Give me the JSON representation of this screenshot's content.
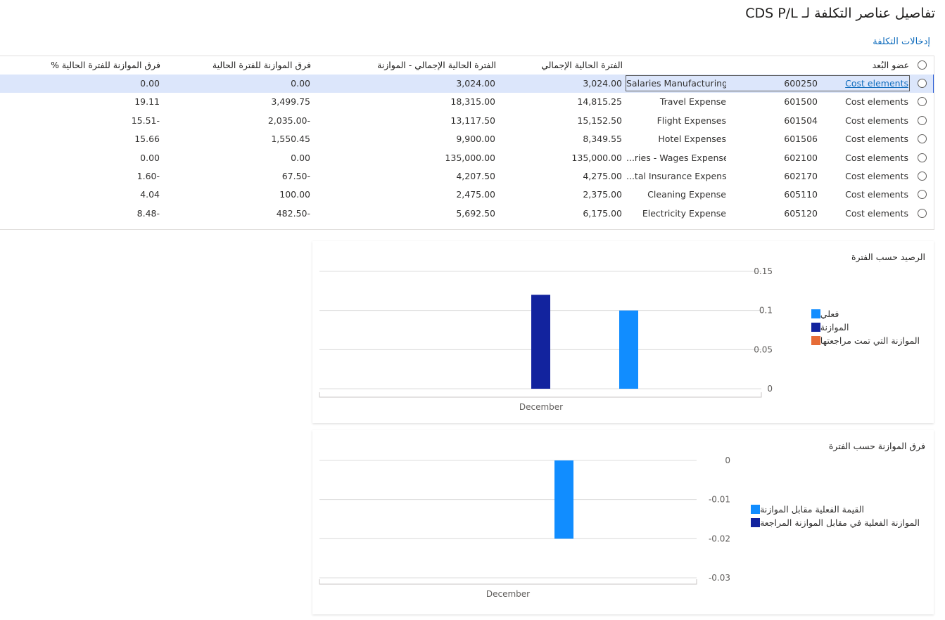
{
  "page": {
    "title": "تفاصيل عناصر التكلفة لـ CDS P/L",
    "entries_link": "إدخالات التكلفة"
  },
  "grid": {
    "headers": {
      "member": "عضو البُعد",
      "current_total": "الفترة الحالية الإجمالي",
      "current_minus_budget": "الفترة الحالية الإجمالي - الموازنة",
      "budget_variance": "فرق الموازنة للفترة الحالية",
      "budget_variance_pct": "فرق الموازنة للفترة الحالية %"
    },
    "rows": [
      {
        "type": "Cost elements",
        "code": "600250",
        "name": "Salaries Manufacturing",
        "current_total": "3,024.00",
        "current_minus_budget": "3,024.00",
        "variance": "0.00",
        "variance_pct": "0.00"
      },
      {
        "type": "Cost elements",
        "code": "601500",
        "name": "Travel Expense",
        "current_total": "14,815.25",
        "current_minus_budget": "18,315.00",
        "variance": "3,499.75",
        "variance_pct": "19.11"
      },
      {
        "type": "Cost elements",
        "code": "601504",
        "name": "Flight Expenses",
        "current_total": "15,152.50",
        "current_minus_budget": "13,117.50",
        "variance": "-2,035.00",
        "variance_pct": "-15.51"
      },
      {
        "type": "Cost elements",
        "code": "601506",
        "name": "Hotel Expenses",
        "current_total": "8,349.55",
        "current_minus_budget": "9,900.00",
        "variance": "1,550.45",
        "variance_pct": "15.66"
      },
      {
        "type": "Cost elements",
        "code": "602100",
        "name": "...ries - Wages Expense",
        "current_total": "135,000.00",
        "current_minus_budget": "135,000.00",
        "variance": "0.00",
        "variance_pct": "0.00"
      },
      {
        "type": "Cost elements",
        "code": "602170",
        "name": "...tal Insurance Expense",
        "current_total": "4,275.00",
        "current_minus_budget": "4,207.50",
        "variance": "-67.50",
        "variance_pct": "-1.60"
      },
      {
        "type": "Cost elements",
        "code": "605110",
        "name": "Cleaning Expense",
        "current_total": "2,375.00",
        "current_minus_budget": "2,475.00",
        "variance": "100.00",
        "variance_pct": "4.04"
      },
      {
        "type": "Cost elements",
        "code": "605120",
        "name": "Electricity Expense",
        "current_total": "6,175.00",
        "current_minus_budget": "5,692.50",
        "variance": "-482.50",
        "variance_pct": "-8.48"
      }
    ]
  },
  "colors": {
    "actual": "#118dff",
    "budget": "#12239e",
    "revised_budget": "#e66c37",
    "selected_row": "#dce6fb",
    "link": "#0f6cbd"
  },
  "chart_data": [
    {
      "type": "bar",
      "title": "الرصيد حسب الفترة",
      "categories": [
        "December"
      ],
      "series": [
        {
          "name": "فعلي",
          "values": [
            0.1
          ]
        },
        {
          "name": "الموازنة",
          "values": [
            0.12
          ]
        },
        {
          "name": "الموازنة التي تمت مراجعتها",
          "values": [
            0
          ]
        }
      ],
      "y_ticks": [
        "0.15",
        "0.1",
        "0.05",
        "0"
      ],
      "ylim": [
        0,
        0.15
      ],
      "grid": true,
      "legend": "right"
    },
    {
      "type": "bar",
      "title": "فرق الموازنة حسب الفترة",
      "categories": [
        "December"
      ],
      "series": [
        {
          "name": "القيمة الفعلية مقابل الموازنة",
          "values": [
            -0.02
          ]
        },
        {
          "name": "الموازنة الفعلية في مقابل الموازنة المراجعة",
          "values": [
            0
          ]
        }
      ],
      "y_ticks": [
        "0",
        "-0.01",
        "-0.02",
        "-0.03"
      ],
      "ylim": [
        -0.03,
        0
      ],
      "grid": true,
      "legend": "right"
    }
  ]
}
